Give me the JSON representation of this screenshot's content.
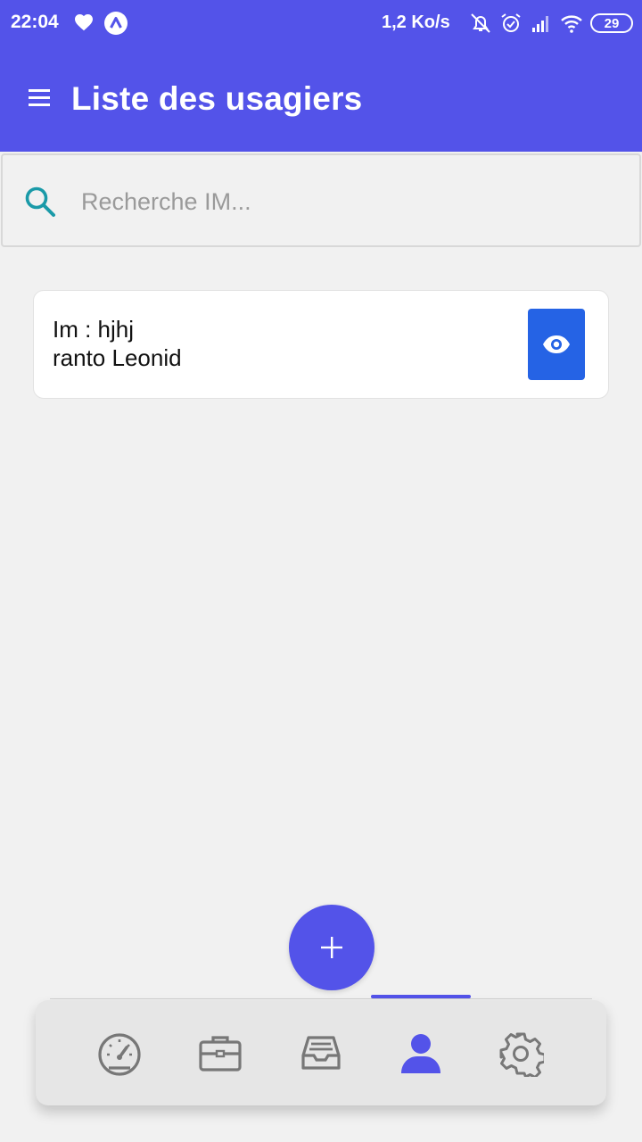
{
  "status_bar": {
    "time": "22:04",
    "network_speed": "1,2 Ko/s",
    "battery": "29",
    "icons": [
      "heart-icon",
      "app-icon",
      "bell-off-icon",
      "alarm-icon",
      "signal-icon",
      "wifi-icon",
      "battery-icon"
    ]
  },
  "app_bar": {
    "title": "Liste des usagiers",
    "menu_icon": "menu-icon"
  },
  "search": {
    "placeholder": "Recherche IM...",
    "value": ""
  },
  "users": [
    {
      "im_line": "Im : hjhj",
      "name": "ranto Leonid",
      "action_icon": "eye-icon"
    }
  ],
  "fab": {
    "icon": "plus-icon"
  },
  "bottom_nav": {
    "items": [
      "dashboard-gauge-icon",
      "briefcase-icon",
      "inbox-tray-icon",
      "user-icon",
      "settings-gear-icon"
    ],
    "active": "user-icon"
  },
  "colors": {
    "primary": "#5353e9",
    "button_blue": "#2563e5",
    "search_icon": "#1a9aa8",
    "nav_inactive": "#777777",
    "background": "#f1f1f1"
  }
}
